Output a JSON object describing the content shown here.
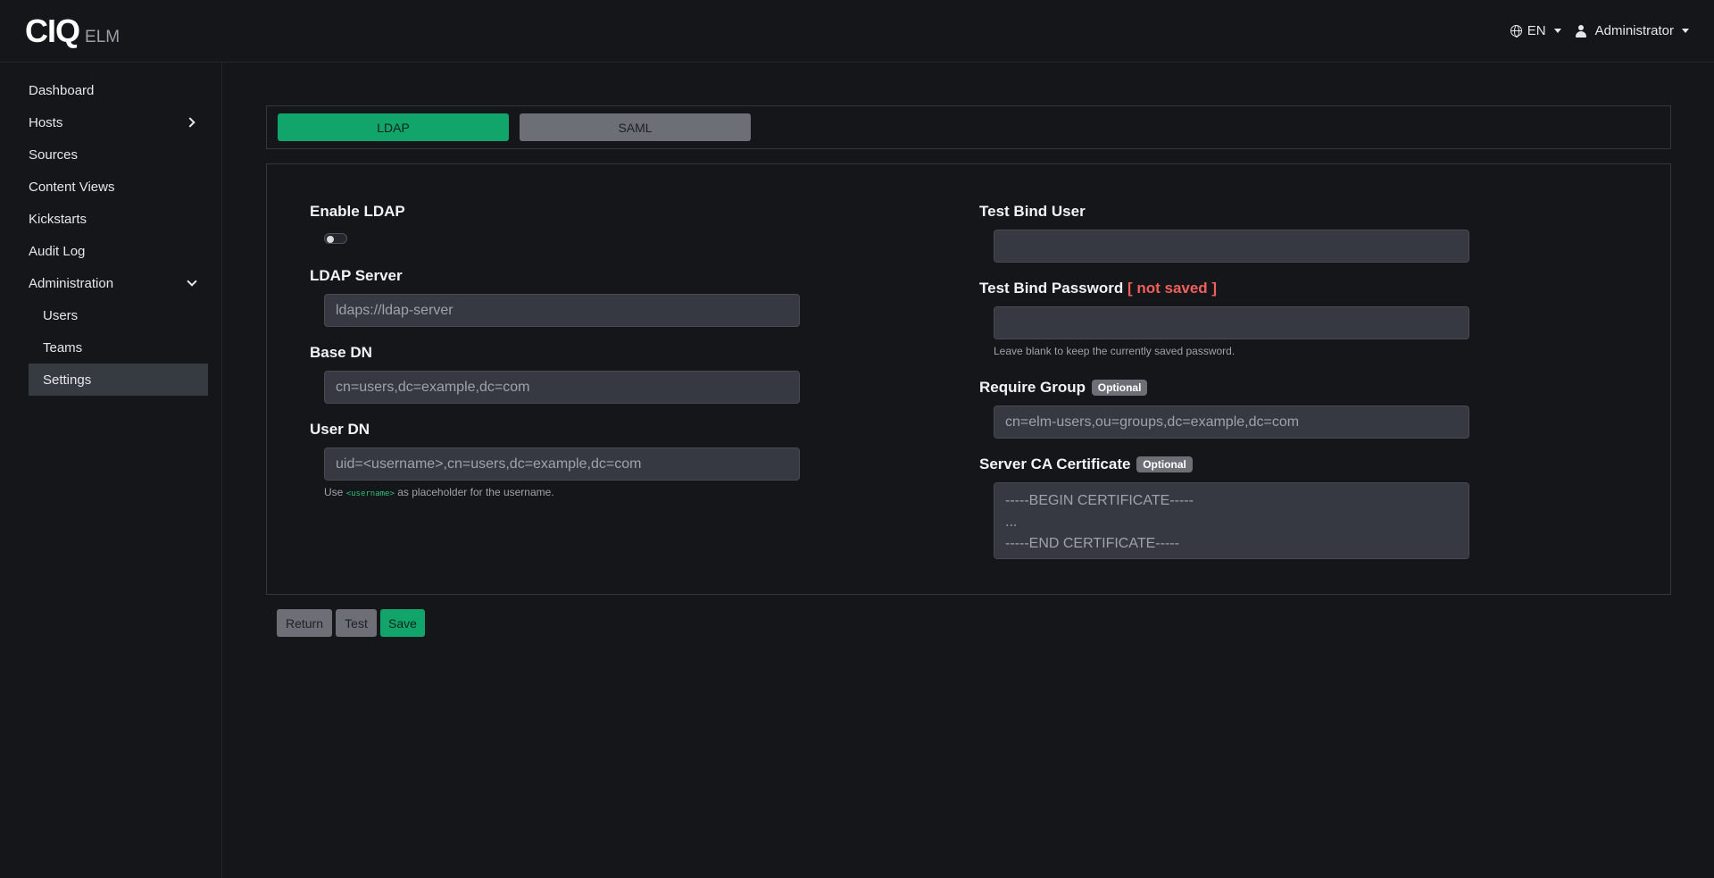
{
  "header": {
    "logo": "CIQ",
    "product": "ELM",
    "language": "EN",
    "user": "Administrator"
  },
  "sidebar": {
    "items": [
      {
        "label": "Dashboard"
      },
      {
        "label": "Hosts"
      },
      {
        "label": "Sources"
      },
      {
        "label": "Content Views"
      },
      {
        "label": "Kickstarts"
      },
      {
        "label": "Audit Log"
      },
      {
        "label": "Administration"
      },
      {
        "label": "Users"
      },
      {
        "label": "Teams"
      },
      {
        "label": "Settings"
      }
    ]
  },
  "tabs": {
    "ldap": "LDAP",
    "saml": "SAML"
  },
  "form": {
    "enable_ldap_label": "Enable LDAP",
    "enable_ldap_value": false,
    "ldap_server_label": "LDAP Server",
    "ldap_server_placeholder": "ldaps://ldap-server",
    "base_dn_label": "Base DN",
    "base_dn_placeholder": "cn=users,dc=example,dc=com",
    "user_dn_label": "User DN",
    "user_dn_placeholder": "uid=<username>,cn=users,dc=example,dc=com",
    "user_dn_help_prefix": "Use",
    "user_dn_help_code": "<username>",
    "user_dn_help_suffix": "as placeholder for the username.",
    "test_bind_user_label": "Test Bind User",
    "test_bind_user_value": "",
    "test_bind_password_label": "Test Bind Password",
    "test_bind_password_warn": "[ not saved ]",
    "test_bind_password_value": "",
    "test_bind_password_help": "Leave blank to keep the currently saved password.",
    "require_group_label": "Require Group",
    "optional_badge": "Optional",
    "require_group_placeholder": "cn=elm-users,ou=groups,dc=example,dc=com",
    "server_ca_label": "Server CA Certificate",
    "server_ca_placeholder": "-----BEGIN CERTIFICATE-----\n...\n-----END CERTIFICATE-----"
  },
  "actions": {
    "return": "Return",
    "test": "Test",
    "save": "Save"
  },
  "colors": {
    "accent": "#12a56b",
    "warning": "#f0605a",
    "background": "#14161a"
  }
}
